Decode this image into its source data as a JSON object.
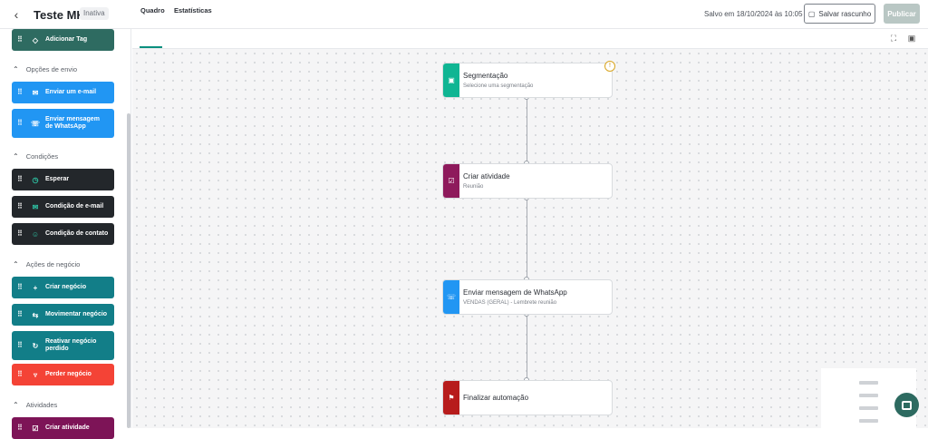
{
  "header": {
    "back_icon": "chevron-left-icon",
    "title": "Teste MKT",
    "status_badge": "Inativa",
    "saved_text": "Salvo em 18/10/2024 às 10:05",
    "save_draft_label": "Salvar rascunho",
    "publish_label": "Publicar"
  },
  "sidebar": {
    "items_top": [
      {
        "label": "Adicionar Tag",
        "icon": "tag-icon",
        "color": "#2e6b61"
      }
    ],
    "sections": [
      {
        "title": "Opções de envio",
        "items": [
          {
            "label": "Enviar um e-mail",
            "icon": "mail-icon",
            "color": "#2196f3"
          },
          {
            "label": "Enviar mensagem de WhatsApp",
            "icon": "whatsapp-icon",
            "color": "#2196f3"
          }
        ]
      },
      {
        "title": "Condições",
        "items": [
          {
            "label": "Esperar",
            "icon": "timer-icon",
            "color": "#23272b"
          },
          {
            "label": "Condição de e-mail",
            "icon": "mail-icon",
            "color": "#23272b"
          },
          {
            "label": "Condição de contato",
            "icon": "user-icon",
            "color": "#23272b"
          }
        ]
      },
      {
        "title": "Ações de negócio",
        "items": [
          {
            "label": "Criar negócio",
            "icon": "plus-icon",
            "color": "#127e88"
          },
          {
            "label": "Movimentar negócio",
            "icon": "swap-icon",
            "color": "#127e88"
          },
          {
            "label": "Reativar negócio perdido",
            "icon": "refresh-icon",
            "color": "#127e88"
          },
          {
            "label": "Perder negócio",
            "icon": "thumbs-down-icon",
            "color": "#f44336"
          }
        ]
      },
      {
        "title": "Atividades",
        "items": [
          {
            "label": "Criar atividade",
            "icon": "checkbox-icon",
            "color": "#7d1457"
          }
        ]
      }
    ]
  },
  "tabs": {
    "board": "Quadro",
    "stats": "Estatísticas"
  },
  "flow": {
    "nodes": [
      {
        "title": "Segmentação",
        "subtitle": "Selecione uma segmentação",
        "icon": "segment-icon",
        "color": "#0fb593"
      },
      {
        "title": "Criar atividade",
        "subtitle": "Reunião",
        "icon": "checkbox-icon",
        "color": "#8e1a5c"
      },
      {
        "title": "Enviar mensagem de WhatsApp",
        "subtitle": "VENDAS (GERAL) - Lembrete reunião",
        "icon": "whatsapp-icon",
        "color": "#2196f3"
      },
      {
        "title": "Finalizar automação",
        "subtitle": "",
        "icon": "flag-icon",
        "color": "#b71c1c"
      }
    ],
    "warning_icon": "warning-icon"
  }
}
